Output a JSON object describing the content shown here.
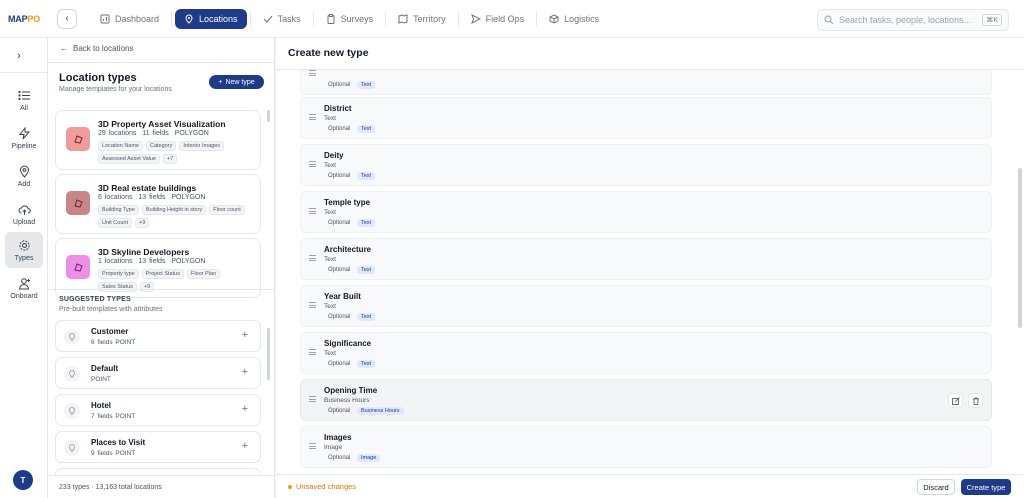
{
  "app": {
    "logo_text": "MAP",
    "logo_accent": "PO"
  },
  "nav": {
    "tabs": [
      {
        "label": "Dashboard",
        "icon": "bar-chart-icon"
      },
      {
        "label": "Locations",
        "icon": "map-pin-icon",
        "active": true
      },
      {
        "label": "Tasks",
        "icon": "check-icon"
      },
      {
        "label": "Surveys",
        "icon": "clipboard-icon"
      },
      {
        "label": "Territory",
        "icon": "map-icon"
      },
      {
        "label": "Field Ops",
        "icon": "send-icon"
      },
      {
        "label": "Logistics",
        "icon": "box-icon"
      }
    ]
  },
  "search": {
    "placeholder": "Search tasks, people, locations...",
    "shortcut": "⌘K"
  },
  "rail": {
    "items": [
      {
        "label": "All",
        "icon": "list-icon"
      },
      {
        "label": "Pipeline",
        "icon": "zap-icon"
      },
      {
        "label": "Add",
        "icon": "map-pin-icon"
      },
      {
        "label": "Upload",
        "icon": "cloud-upload-icon"
      },
      {
        "label": "Types",
        "icon": "gear-icon",
        "active": true
      },
      {
        "label": "Onboard",
        "icon": "user-plus-icon"
      }
    ],
    "avatar_initial": "T"
  },
  "panel": {
    "back_label": "Back to locations",
    "title": "Location types",
    "subtitle": "Manage templates for your locations",
    "new_type_label": "New type",
    "types": [
      {
        "name": "3D Property Asset Visualization",
        "locations": "29 locations",
        "fields": "11 fields",
        "geometry": "POLYGON",
        "chips": [
          "Location Name",
          "Category",
          "Interior Images",
          "Assessed Asset Value",
          "+7"
        ],
        "color": "#f29b9b"
      },
      {
        "name": "3D Real estate buildings",
        "locations": "6 locations",
        "fields": "13 fields",
        "geometry": "POLYGON",
        "chips": [
          "Building Type",
          "Building Height in story",
          "Floor count",
          "Unit Count",
          "+9"
        ],
        "color": "#c98686"
      },
      {
        "name": "3D Skyline Developers",
        "locations": "1 locations",
        "fields": "13 fields",
        "geometry": "POLYGON",
        "chips": [
          "Property type",
          "Project Status",
          "Floor Plan",
          "Sales Status",
          "+9"
        ],
        "color": "#ee8ee6"
      }
    ],
    "suggested_title": "SUGGESTED TYPES",
    "suggested_subtitle": "Pre-built templates with attributes",
    "suggested": [
      {
        "name": "Customer",
        "meta": "6 fields  POINT"
      },
      {
        "name": "Default",
        "meta": "POINT"
      },
      {
        "name": "Hotel",
        "meta": "7 fields  POINT"
      },
      {
        "name": "Places to Visit",
        "meta": "9 fields  POINT"
      }
    ],
    "footer": "233 types · 13,163 total locations"
  },
  "main": {
    "title": "Create new type",
    "fields": [
      {
        "name": "",
        "type": "",
        "optional": "Optional",
        "badge": "Text"
      },
      {
        "name": "District",
        "type": "Text",
        "optional": "Optional",
        "badge": "Text"
      },
      {
        "name": "Deity",
        "type": "Text",
        "optional": "Optional",
        "badge": "Text"
      },
      {
        "name": "Temple type",
        "type": "Text",
        "optional": "Optional",
        "badge": "Text"
      },
      {
        "name": "Architecture",
        "type": "Text",
        "optional": "Optional",
        "badge": "Text"
      },
      {
        "name": "Year Built",
        "type": "Text",
        "optional": "Optional",
        "badge": "Text"
      },
      {
        "name": "Significance",
        "type": "Text",
        "optional": "Optional",
        "badge": "Text"
      },
      {
        "name": "Opening Time",
        "type": "Business Hours",
        "optional": "Optional",
        "badge": "Business Hours",
        "hovered": true
      },
      {
        "name": "Images",
        "type": "Image",
        "optional": "Optional",
        "badge": "Image"
      }
    ],
    "unsaved": "Unsaved changes",
    "discard_label": "Discard",
    "create_label": "Create type"
  },
  "colors": {
    "primary": "#1e3a8a",
    "warning": "#d97706"
  }
}
